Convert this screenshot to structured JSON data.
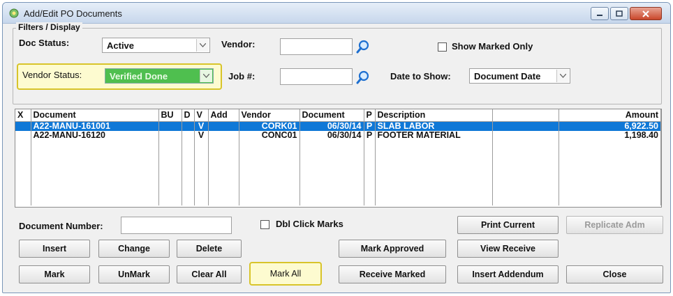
{
  "window": {
    "title": "Add/Edit PO Documents"
  },
  "filters": {
    "legend": "Filters / Display",
    "doc_status_label": "Doc Status:",
    "doc_status_value": "Active",
    "vendor_label": "Vendor:",
    "vendor_value": "",
    "show_marked_only_label": "Show Marked Only",
    "vendor_status_label": "Vendor Status:",
    "vendor_status_value": "Verified Done",
    "job_label": "Job #:",
    "job_value": "",
    "date_to_show_label": "Date to Show:",
    "date_to_show_value": "Document Date"
  },
  "grid": {
    "headers": [
      "X",
      "Document",
      "BU",
      "D",
      "V",
      "Add",
      "Vendor",
      "Document",
      "P",
      "Description",
      "",
      "Amount"
    ],
    "rows": [
      {
        "x": "",
        "document": "A22-MANU-161001",
        "bu": "",
        "d": "",
        "v": "V",
        "add": "",
        "vendor": "CORK01",
        "doc_date": "06/30/14",
        "p": "P",
        "description": "SLAB LABOR",
        "extra": "",
        "amount": "6,922.50"
      },
      {
        "x": "",
        "document": "A22-MANU-16120",
        "bu": "",
        "d": "",
        "v": "V",
        "add": "",
        "vendor": "CONC01",
        "doc_date": "06/30/14",
        "p": "P",
        "description": "FOOTER MATERIAL",
        "extra": "",
        "amount": "1,198.40"
      }
    ]
  },
  "bottom": {
    "document_number_label": "Document Number:",
    "document_number_value": "",
    "dbl_click_marks_label": "Dbl Click Marks"
  },
  "buttons": {
    "print_current": "Print Current",
    "replicate_adm": "Replicate Adm",
    "insert": "Insert",
    "change": "Change",
    "delete": "Delete",
    "mark_approved": "Mark Approved",
    "view_receive": "View Receive",
    "mark": "Mark",
    "unmark": "UnMark",
    "clear_all": "Clear All",
    "mark_all": "Mark All",
    "receive_marked": "Receive Marked",
    "insert_addendum": "Insert Addendum",
    "close": "Close"
  },
  "colors": {
    "selection": "#0f78d7",
    "highlight": "#d8c42a",
    "vendor_status_fill": "#4fbf4f"
  }
}
